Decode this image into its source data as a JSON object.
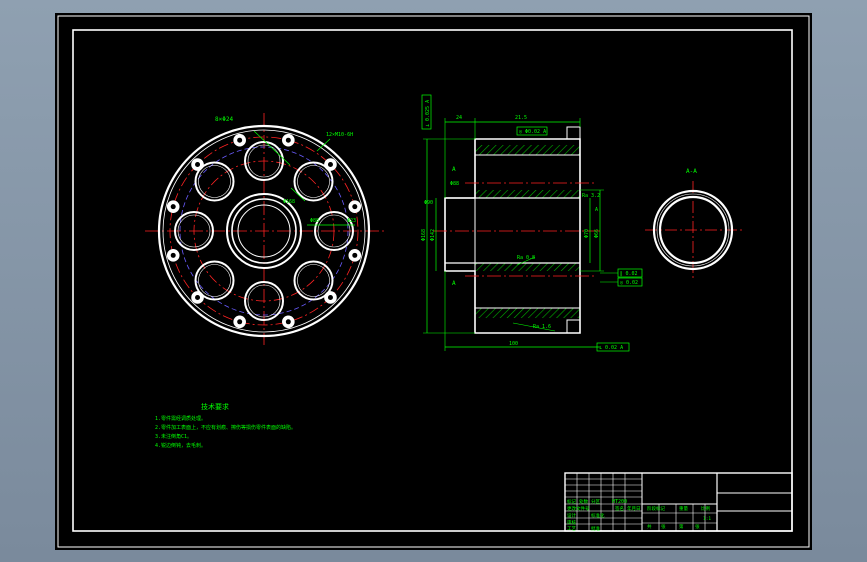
{
  "colors": {
    "frame": "#ffffff",
    "outline": "#ffffff",
    "centerline": "#ff2222",
    "dimension": "#00ff00",
    "hatch": "#00d000",
    "hidden": "#6a5cff",
    "background": "#000000"
  },
  "flange_view": {
    "bolt_hole_count": 8,
    "edge_notch_count": 12,
    "callouts": [
      "8×Φ24",
      "12×M10-6H",
      "Φ168",
      "Φ88",
      "Φ23"
    ]
  },
  "section_view": {
    "top_dims": [
      "24",
      "21.5"
    ],
    "tolerance_frames": [
      "⊥ 0.025 A",
      "◎ Φ0.02 A",
      "∥ 0.02",
      "◎ 0.02",
      "⊥ 0.02 A"
    ],
    "left_dims": [
      "Φ168",
      "Φ142",
      "Φ90",
      "Φ88"
    ],
    "right_dims": [
      "Φ70",
      "Φ66"
    ],
    "surface_labels": [
      "Ra 0.8",
      "Ra 1.6",
      "Ra 3.2"
    ],
    "section_marks": [
      "A",
      "A"
    ],
    "datum": "A",
    "bottom_dim": "100"
  },
  "detail_view": {
    "label": "A-A"
  },
  "tech_notes": {
    "heading": "技术要求",
    "lines": [
      "1.零件需经调质处理。",
      "2.零件加工表面上，不应有划痕、擦伤等损伤零件表面的缺陷。",
      "3.未注倒角C1。",
      "4.锐边倒钝，去毛刺。"
    ]
  },
  "title_block": {
    "material": "HT200",
    "scale": "1:1",
    "left_labels": [
      "标记",
      "处数",
      "分区",
      "更改文件号",
      "签名",
      "年月日"
    ],
    "stage_label": "阶段标记",
    "weight_label": "重量",
    "ratio_label": "比例",
    "sheet_labels": [
      "共",
      "张",
      "第",
      "张"
    ],
    "designer_labels": [
      "设计",
      "标准化",
      "审核",
      "工艺",
      "批准"
    ]
  }
}
